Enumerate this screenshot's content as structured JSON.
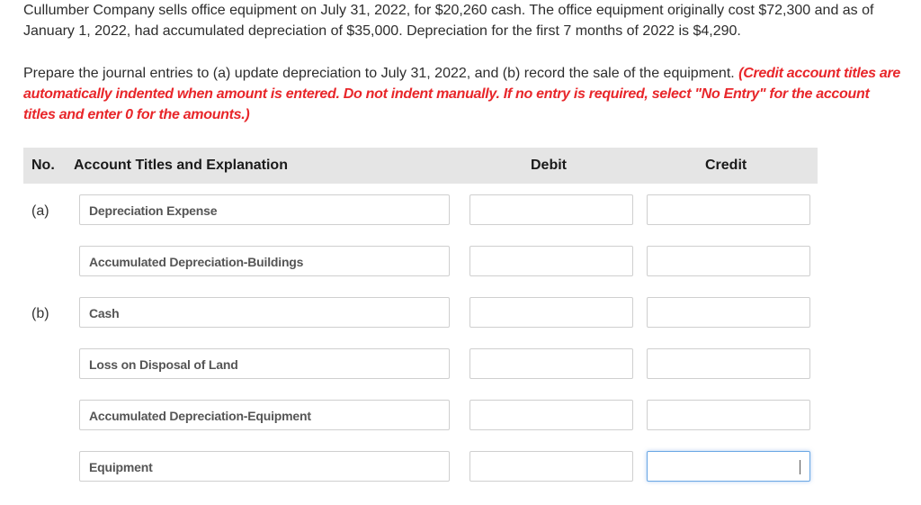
{
  "problem": {
    "statement": "Cullumber Company sells office equipment on July 31, 2022, for $20,260 cash. The office equipment originally cost $72,300 and as of January 1, 2022, had accumulated depreciation of $35,000. Depreciation for the first 7 months of 2022 is $4,290.",
    "instruction": "Prepare the journal entries to (a) update depreciation to July 31, 2022, and (b) record the sale of the equipment.",
    "note": "(Credit account titles are automatically indented when amount is entered. Do not indent manually. If no entry is required, select \"No Entry\" for the account titles and enter 0 for the amounts.)"
  },
  "table": {
    "headers": {
      "no": "No.",
      "account": "Account Titles and Explanation",
      "debit": "Debit",
      "credit": "Credit"
    },
    "rows": [
      {
        "no": "(a)",
        "account": "Depreciation Expense",
        "debit": "",
        "credit": ""
      },
      {
        "no": "",
        "account": "Accumulated Depreciation-Buildings",
        "debit": "",
        "credit": ""
      },
      {
        "no": "(b)",
        "account": "Cash",
        "debit": "",
        "credit": ""
      },
      {
        "no": "",
        "account": "Loss on Disposal of Land",
        "debit": "",
        "credit": ""
      },
      {
        "no": "",
        "account": "Accumulated Depreciation-Equipment",
        "debit": "",
        "credit": ""
      },
      {
        "no": "",
        "account": "Equipment",
        "debit": "",
        "credit": ""
      }
    ]
  },
  "colors": {
    "note_red": "#e8262a",
    "header_bg": "#e5e5e5",
    "focus_border": "#6aa7e4"
  }
}
